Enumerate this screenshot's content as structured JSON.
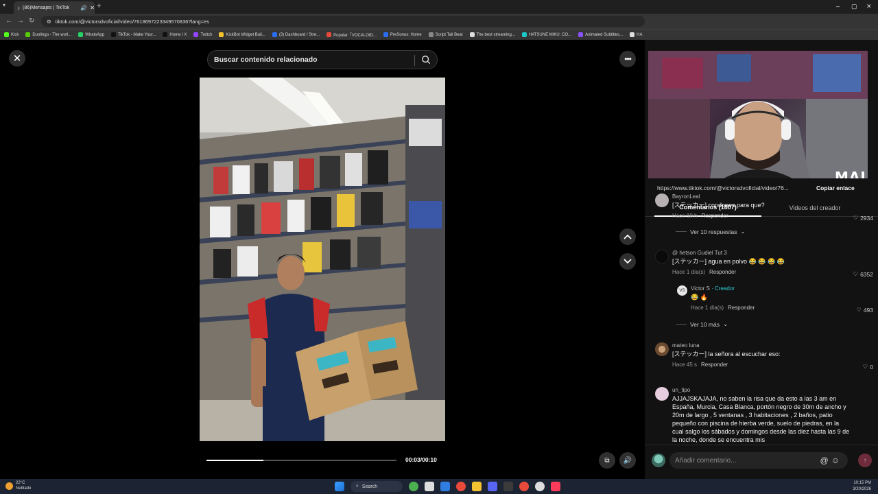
{
  "browser": {
    "tab_title": "(86)Mensajes | TikTok",
    "url": "tiktok.com/@victorsdvoficial/video/7618697223349570836?lang=es",
    "bookmarks": [
      "Kick",
      "Duolingo - The worl...",
      "WhatsApp",
      "TikTok - Make Your...",
      "Home / X",
      "Twitch",
      "KickBot Widget Buil...",
      "(3) Dashboard / Stre...",
      "Popular「VOCALOID...",
      "PreSonus: Home",
      "Script Tail Beat",
      "The best streaming...",
      "HATSUNE MIKU: CO...",
      "Animated Subtitles...",
      "HA"
    ]
  },
  "search": {
    "placeholder": "Buscar contenido relacionado"
  },
  "video": {
    "progress": 0.3,
    "timecode": "00:03/00:10"
  },
  "webcam": {
    "overlay_text": "MAI"
  },
  "share": {
    "url": "https://www.tiktok.com/@victorsdvoficial/video/76...",
    "copy_label": "Copiar enlace"
  },
  "tabs": {
    "comments": "Comentarios (1807)",
    "creator_videos": "Videos del creador"
  },
  "comments": [
    {
      "user": "BayronLeal",
      "text": "[ステッカー] condones para que?",
      "time": "Hace 10 h",
      "reply": "Responder",
      "likes": "2934",
      "more": "Ver 10 respuestas"
    },
    {
      "user": "@ hetson Gudiel Tut 3",
      "text": "[ステッカー] agua en polvo 😂 😂 😂 😂",
      "time": "Hace 1 día(s)",
      "reply": "Responder",
      "likes": "6352"
    },
    {
      "user": "Victor S",
      "badge": "· Creador",
      "text": "😂 🔥",
      "time": "Hace 1 día(s)",
      "reply": "Responder",
      "likes": "493",
      "more": "Ver 10 más"
    },
    {
      "user": "mateo luna",
      "text": "[ステッカー] la señora al escuchar eso:",
      "time": "Hace 45 s",
      "reply": "Responder",
      "likes": "0"
    },
    {
      "user": "un_tipo",
      "text": "AJJAJSKAJAJA, no saben la risa que da esto a las 3 am en España, Murcia, Casa Blanca, portón negro de 30m de ancho y 20m de largo , 5 ventanas , 3 habitaciones , 2 baños, patio pequeño con piscina de hierba verde, suelo de piedras, en la cual salgo los sábados y domingos desde las diez hasta las 9 de la noche, donde se encuentra mis"
    }
  ],
  "comment_input": {
    "placeholder": "Añadir comentario..."
  },
  "taskbar": {
    "temp": "22°C",
    "weather": "Nublado",
    "search": "Search",
    "time": "10:15 PM",
    "date": "3/20/2026"
  },
  "colors": {
    "creator_accent": "#2ccfd4",
    "send_button": "#6e2c3b"
  }
}
